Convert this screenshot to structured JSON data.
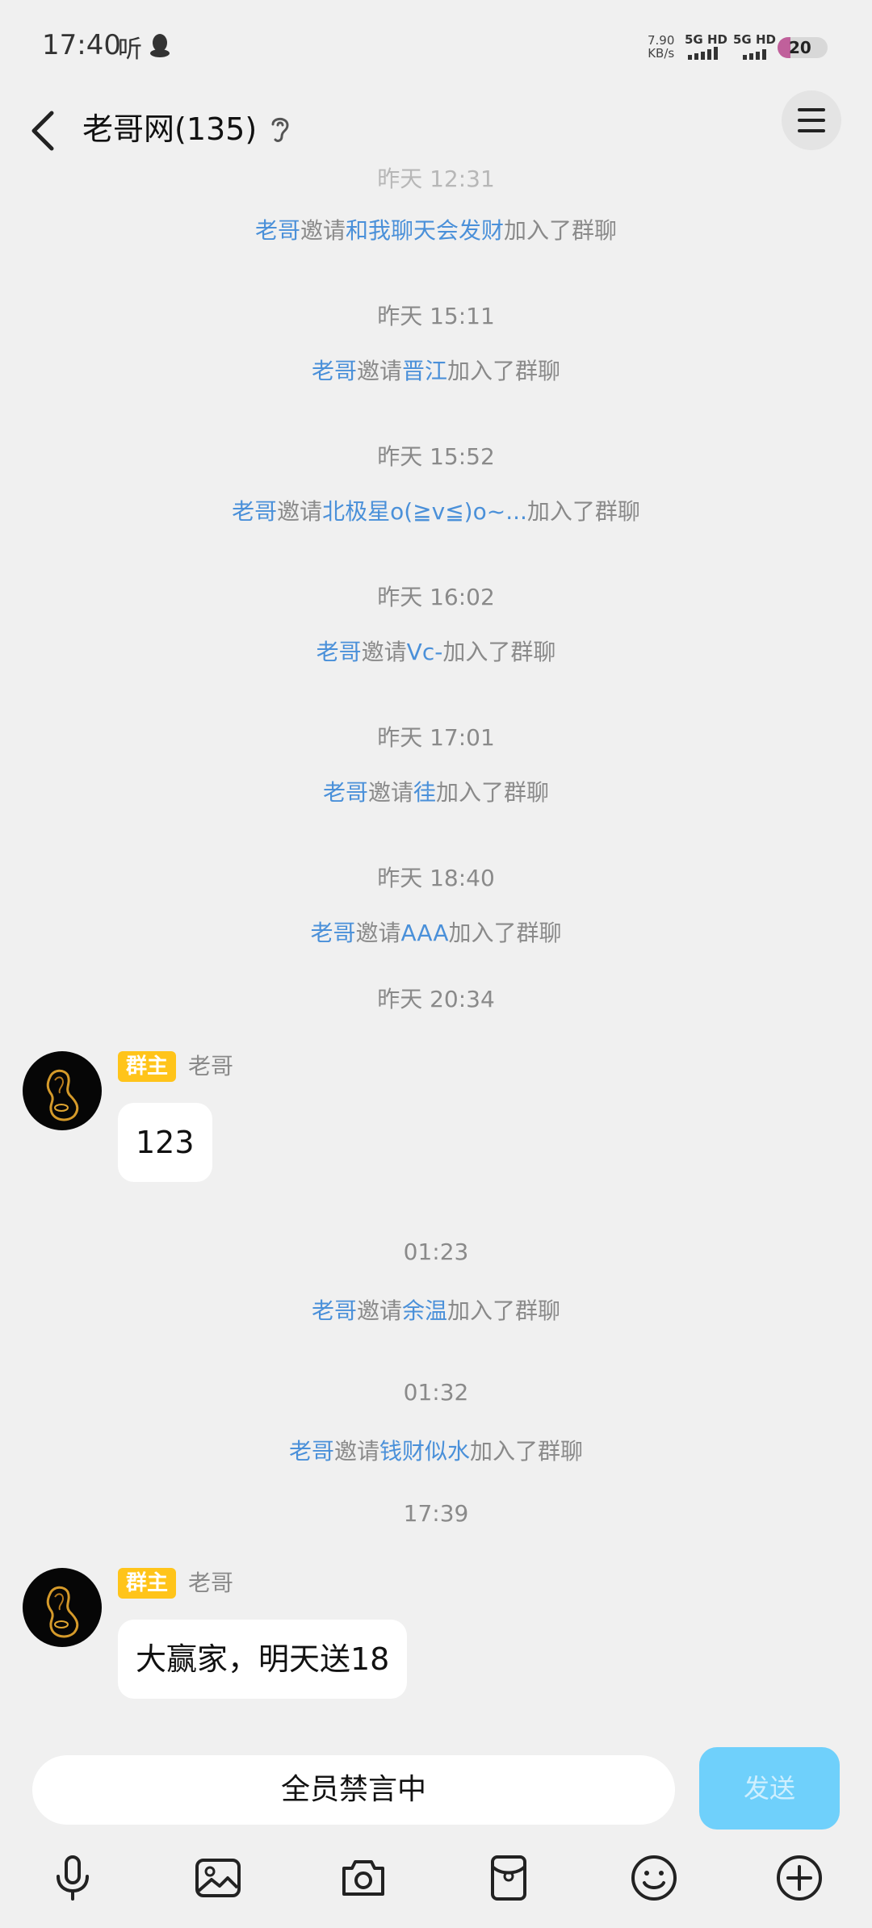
{
  "status_bar": {
    "time": "17:40",
    "indicator": "听",
    "net_speed": "7.90",
    "net_unit": "KB/s",
    "sim1": "5G HD",
    "sim2": "5G HD",
    "battery": "20"
  },
  "header": {
    "title": "老哥网(135)"
  },
  "chat": {
    "faded_timestamp": "昨天 12:31",
    "items": [
      {
        "time": "昨天 15:11",
        "inviter": "老哥",
        "verb": "邀请",
        "invitee": "晋江",
        "suffix": "加入了群聊"
      },
      {
        "time": "昨天 15:52",
        "inviter": "老哥",
        "verb": "邀请",
        "invitee": "北极星o(≧v≦)o~...",
        "suffix": "加入了群聊"
      },
      {
        "time": "昨天 16:02",
        "inviter": "老哥",
        "verb": "邀请",
        "invitee": "Vc-",
        "suffix": "加入了群聊"
      },
      {
        "time": "昨天 17:01",
        "inviter": "老哥",
        "verb": "邀请",
        "invitee": "徍",
        "suffix": "加入了群聊"
      },
      {
        "time": "昨天 18:40",
        "inviter": "老哥",
        "verb": "邀请",
        "invitee": "AAA",
        "suffix": "加入了群聊"
      }
    ],
    "first_event": {
      "inviter": "老哥",
      "verb": "邀请",
      "invitee": "和我聊天会发财",
      "suffix": "加入了群聊"
    },
    "ts_2034": "昨天 20:34",
    "msg1": {
      "badge": "群主",
      "sender": "老哥",
      "text": "123"
    },
    "ts_0123": "01:23",
    "event_0123": {
      "inviter": "老哥",
      "verb": "邀请",
      "invitee": "余温",
      "suffix": "加入了群聊"
    },
    "ts_0132": "01:32",
    "event_0132": {
      "inviter": "老哥",
      "verb": "邀请",
      "invitee": "钱财似水",
      "suffix": "加入了群聊"
    },
    "ts_1739": "17:39",
    "msg2": {
      "badge": "群主",
      "sender": "老哥",
      "text": "大赢家，明天送18"
    }
  },
  "input_bar": {
    "muted_text": "全员禁言中",
    "send_label": "发送"
  },
  "toolbar": {
    "icons": [
      "microphone-icon",
      "image-icon",
      "camera-icon",
      "red-packet-icon",
      "emoji-icon",
      "plus-icon"
    ]
  },
  "colors": {
    "link": "#4a90d9",
    "badge": "#ffc41a",
    "send_disabled": "#6fd0fb",
    "background": "#f0f0f0"
  }
}
